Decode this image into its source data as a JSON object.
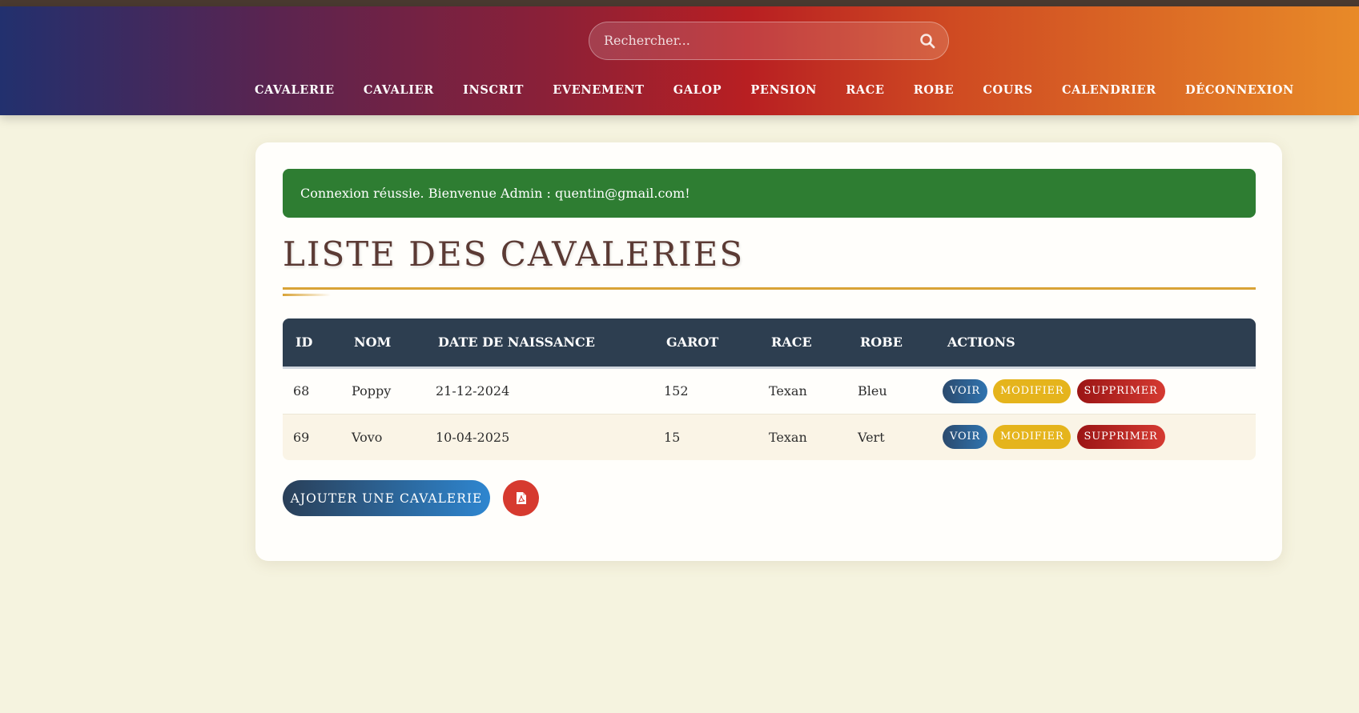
{
  "search": {
    "placeholder": "Rechercher..."
  },
  "nav": {
    "items": [
      "CAVALERIE",
      "CAVALIER",
      "INSCRIT",
      "EVENEMENT",
      "GALOP",
      "PENSION",
      "RACE",
      "ROBE",
      "COURS",
      "CALENDRIER",
      "DÉCONNEXION"
    ]
  },
  "alert": {
    "message": "Connexion réussie. Bienvenue Admin : quentin@gmail.com!"
  },
  "page": {
    "title": "LISTE DES CAVALERIES"
  },
  "table": {
    "headers": [
      "ID",
      "NOM",
      "DATE DE NAISSANCE",
      "GAROT",
      "RACE",
      "ROBE",
      "ACTIONS"
    ],
    "rows": [
      {
        "id": "68",
        "nom": "Poppy",
        "date": "21-12-2024",
        "garot": "152",
        "race": "Texan",
        "robe": "Bleu"
      },
      {
        "id": "69",
        "nom": "Vovo",
        "date": "10-04-2025",
        "garot": "15",
        "race": "Texan",
        "robe": "Vert"
      }
    ],
    "actions": {
      "view": "VOIR",
      "edit": "MODIFIER",
      "delete": "SUPPRIMER"
    }
  },
  "buttons": {
    "add": "AJOUTER UNE CAVALERIE"
  },
  "icons": {
    "search": "search-icon",
    "pdf": "pdf-icon"
  },
  "colors": {
    "alert": "#2e7d32",
    "table_header": "#2d3e50",
    "accent": "#d9a336",
    "edit": "#e5b41c",
    "delete": "#d53a32"
  }
}
